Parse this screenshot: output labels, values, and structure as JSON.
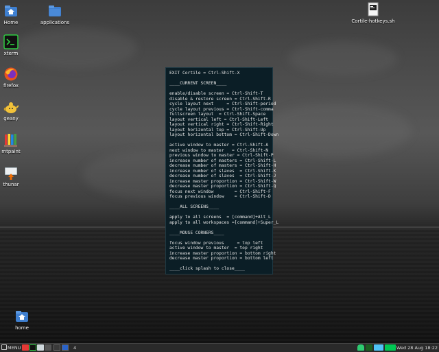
{
  "desktop": {
    "icons": [
      {
        "label": "Home"
      },
      {
        "label": "applications"
      },
      {
        "label": "xterm"
      },
      {
        "label": "firefox"
      },
      {
        "label": "geany"
      },
      {
        "label": "mtpaint"
      },
      {
        "label": "thunar"
      },
      {
        "label": "home"
      },
      {
        "label": "Cortile-hotkeys.sh"
      }
    ]
  },
  "splash": {
    "lines": [
      "EXIT Cortile = Ctrl-Shift-X",
      "",
      "____CURRENT SCREEN____",
      "",
      "enable/disable screen = Ctrl-Shift-T",
      "disable & restore screen = Ctrl-Shift-R",
      "cycle layout next     = Ctrl-Shift-period",
      "cycle layout previous = Ctrl-Shift-comma",
      "fullscreen layout  = Ctrl-Shift-Space",
      "layout vertical left = Ctrl-Shift-Left",
      "layout vertical right = Ctrl-Shift-Right",
      "layout horizontal top = Ctrl-Shift-Up",
      "layout horizontal bottom = Ctrl-Shift-Down",
      "",
      "active window to master = Ctrl-Shift-A",
      "next window to master   = Ctrl-Shift-N",
      "previous window to master = Ctrl-Shift-P",
      "increase number of masters = Ctrl-Shift-L",
      "decrease number of masters = Ctrl-Shift-H",
      "increase number of slaves  = Ctrl-Shift-K",
      "decrease number of slaves  = Ctrl-Shift-J",
      "increase master proportion = Ctrl-Shift-W",
      "decrease master proportion = Ctrl-Shift-Q",
      "focus next window        = Ctrl-Shift-F",
      "focus previous window    = Ctrl-Shift-D",
      "",
      "____ALL SCREENS____",
      "",
      "apply to all screens  = [command]+Alt_L",
      "apply to all workspaces =[command]+Super_L",
      "",
      "____MOUSE CORNERS____",
      "",
      "focus window previous     = top left",
      "active window to master  = top right",
      "increase master proportion = bottom right",
      "decrease master proportion = bottom left",
      "",
      "____click splash to close____"
    ]
  },
  "taskbar": {
    "menu_label": "MENU",
    "workspace_count": "4",
    "clock": "Wed 28 Aug 18:22"
  }
}
